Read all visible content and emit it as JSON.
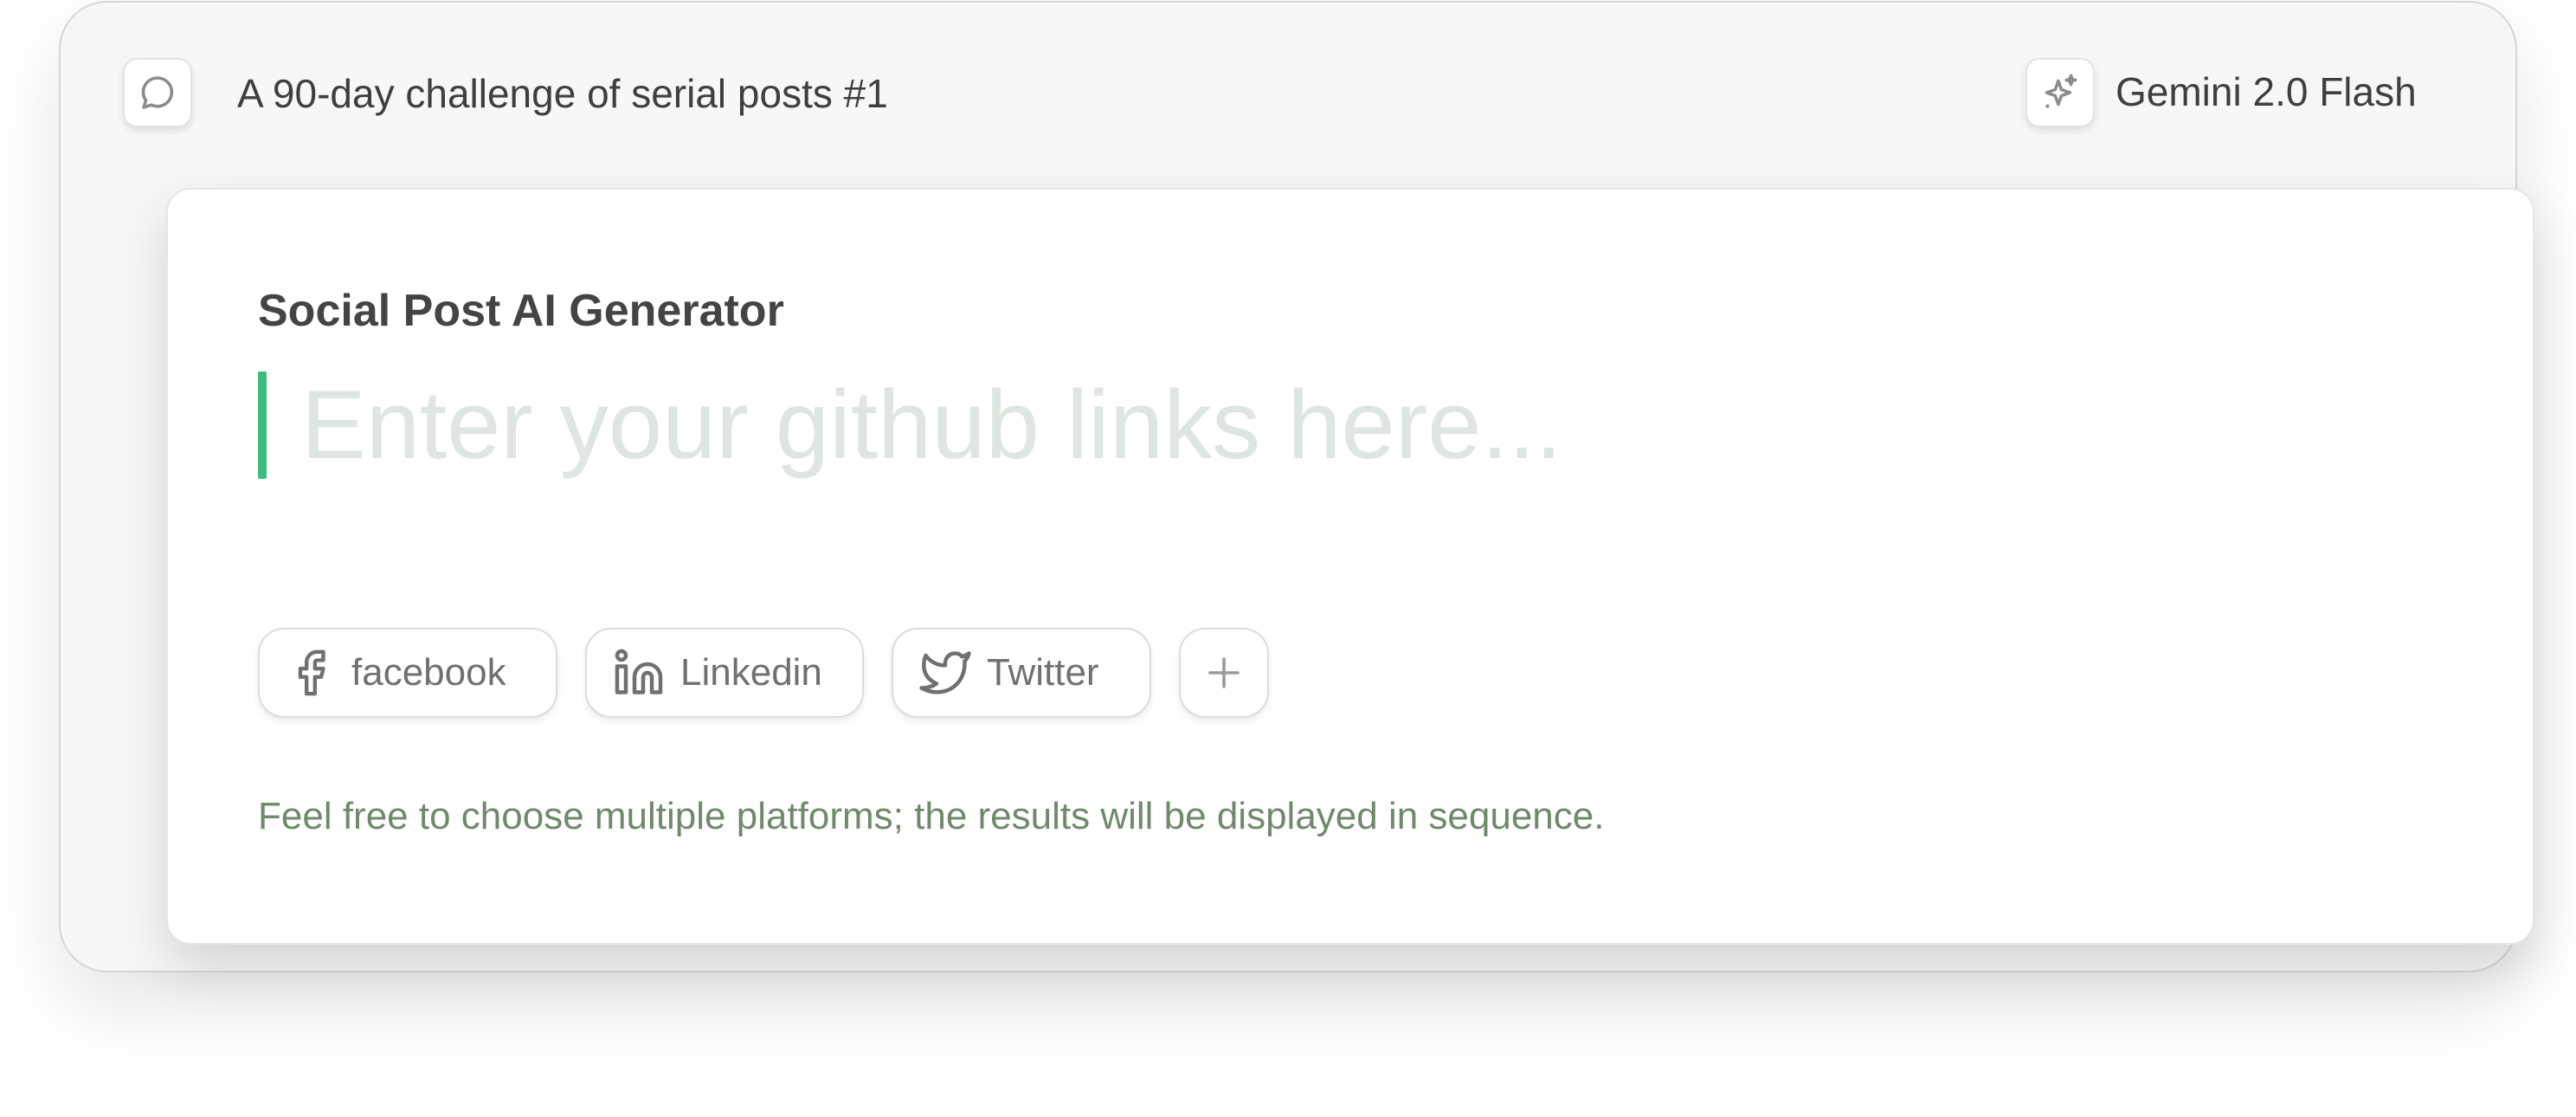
{
  "header": {
    "chat_icon": "speech-bubble-icon",
    "chat_title": "A 90-day challenge of serial posts #1",
    "model_icon": "sparkle-icon",
    "model_name": "Gemini 2.0 Flash"
  },
  "generator": {
    "title": "Social Post AI Generator",
    "input_value": "",
    "input_placeholder": "Enter your github links here...",
    "platforms": [
      {
        "label": "facebook",
        "icon": "facebook-icon"
      },
      {
        "label": "Linkedin",
        "icon": "linkedin-icon"
      },
      {
        "label": "Twitter",
        "icon": "twitter-icon"
      }
    ],
    "add_platform_icon": "plus-icon",
    "helper_text": "Feel free to choose multiple platforms; the results will be displayed in sequence."
  },
  "colors": {
    "accent": "#3dbd7d",
    "helper_text": "#6e8a6a",
    "placeholder": "#dfe5e0",
    "frame_background": "#f7f7f7",
    "card_background": "#ffffff"
  }
}
